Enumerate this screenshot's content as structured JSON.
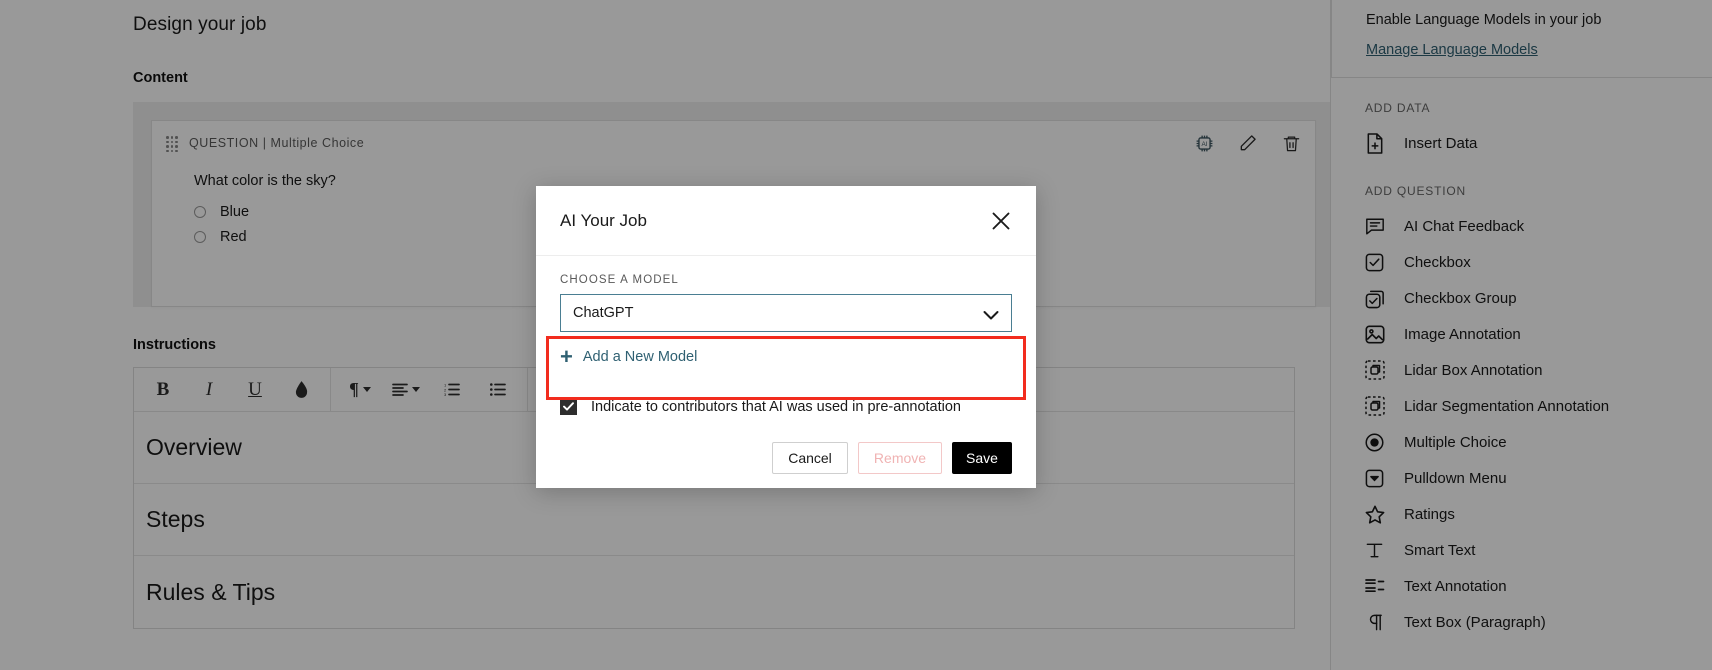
{
  "page": {
    "title": "Design your job",
    "save_label": "Save",
    "content_section_label": "Content",
    "instructions_section_label": "Instructions"
  },
  "question_card": {
    "type_label": "QUESTION | Multiple Choice",
    "drag_handle_icon": "drag-handle-icon",
    "actions": [
      {
        "name": "ai-chip-icon",
        "label": "AI"
      },
      {
        "name": "edit-pencil-icon",
        "label": "Edit"
      },
      {
        "name": "trash-icon",
        "label": "Delete"
      }
    ],
    "question_text": "What color is the sky?",
    "options": [
      "Blue",
      "Red"
    ]
  },
  "editor": {
    "toolbar": [
      {
        "name": "bold-icon",
        "glyph": "B"
      },
      {
        "name": "italic-icon",
        "glyph": "I"
      },
      {
        "name": "underline-icon",
        "glyph": "U"
      },
      {
        "name": "text-color-icon",
        "glyph": "◆"
      },
      {
        "name": "paragraph-format-icon",
        "glyph": "¶"
      },
      {
        "name": "align-icon",
        "glyph": "≡"
      },
      {
        "name": "ordered-list-icon",
        "glyph": "list"
      },
      {
        "name": "unordered-list-icon",
        "glyph": "list"
      },
      {
        "name": "link-icon",
        "glyph": "link"
      }
    ],
    "rows": [
      "Overview",
      "Steps",
      "Rules & Tips"
    ]
  },
  "sidebar": {
    "language_models": {
      "text": "Enable Language Models in your job",
      "link": "Manage Language Models"
    },
    "add_data_heading": "ADD DATA",
    "add_data_items": [
      {
        "label": "Insert Data",
        "icon": "insert-data-icon"
      }
    ],
    "add_question_heading": "ADD QUESTION",
    "add_question_items": [
      {
        "label": "AI Chat Feedback",
        "icon": "chat-bubble-icon"
      },
      {
        "label": "Checkbox",
        "icon": "checkbox-icon"
      },
      {
        "label": "Checkbox Group",
        "icon": "checkbox-group-icon"
      },
      {
        "label": "Image Annotation",
        "icon": "image-icon"
      },
      {
        "label": "Lidar Box Annotation",
        "icon": "lidar-box-icon"
      },
      {
        "label": "Lidar Segmentation Annotation",
        "icon": "lidar-segmentation-icon"
      },
      {
        "label": "Multiple Choice",
        "icon": "radio-icon"
      },
      {
        "label": "Pulldown Menu",
        "icon": "pulldown-icon"
      },
      {
        "label": "Ratings",
        "icon": "star-icon"
      },
      {
        "label": "Smart Text",
        "icon": "text-t-icon"
      },
      {
        "label": "Text Annotation",
        "icon": "text-annotation-icon"
      },
      {
        "label": "Text Box (Paragraph)",
        "icon": "pilcrow-icon"
      }
    ]
  },
  "modal": {
    "title": "AI Your Job",
    "close_icon": "close-icon",
    "field_label": "CHOOSE A MODEL",
    "selected_model": "ChatGPT",
    "dropdown_icon": "chevron-down-icon",
    "add_model_label": "Add a New Model",
    "add_model_icon": "plus-icon",
    "checkbox_checked": true,
    "checkbox_label": "Indicate to contributors that AI was used in pre-annotation",
    "buttons": {
      "cancel": "Cancel",
      "remove": "Remove",
      "save": "Save"
    }
  },
  "colors": {
    "accent_teal": "#2f6072",
    "highlight_red": "#f22c1e",
    "black": "#000000",
    "remove_pink": "#f0b3b3"
  }
}
